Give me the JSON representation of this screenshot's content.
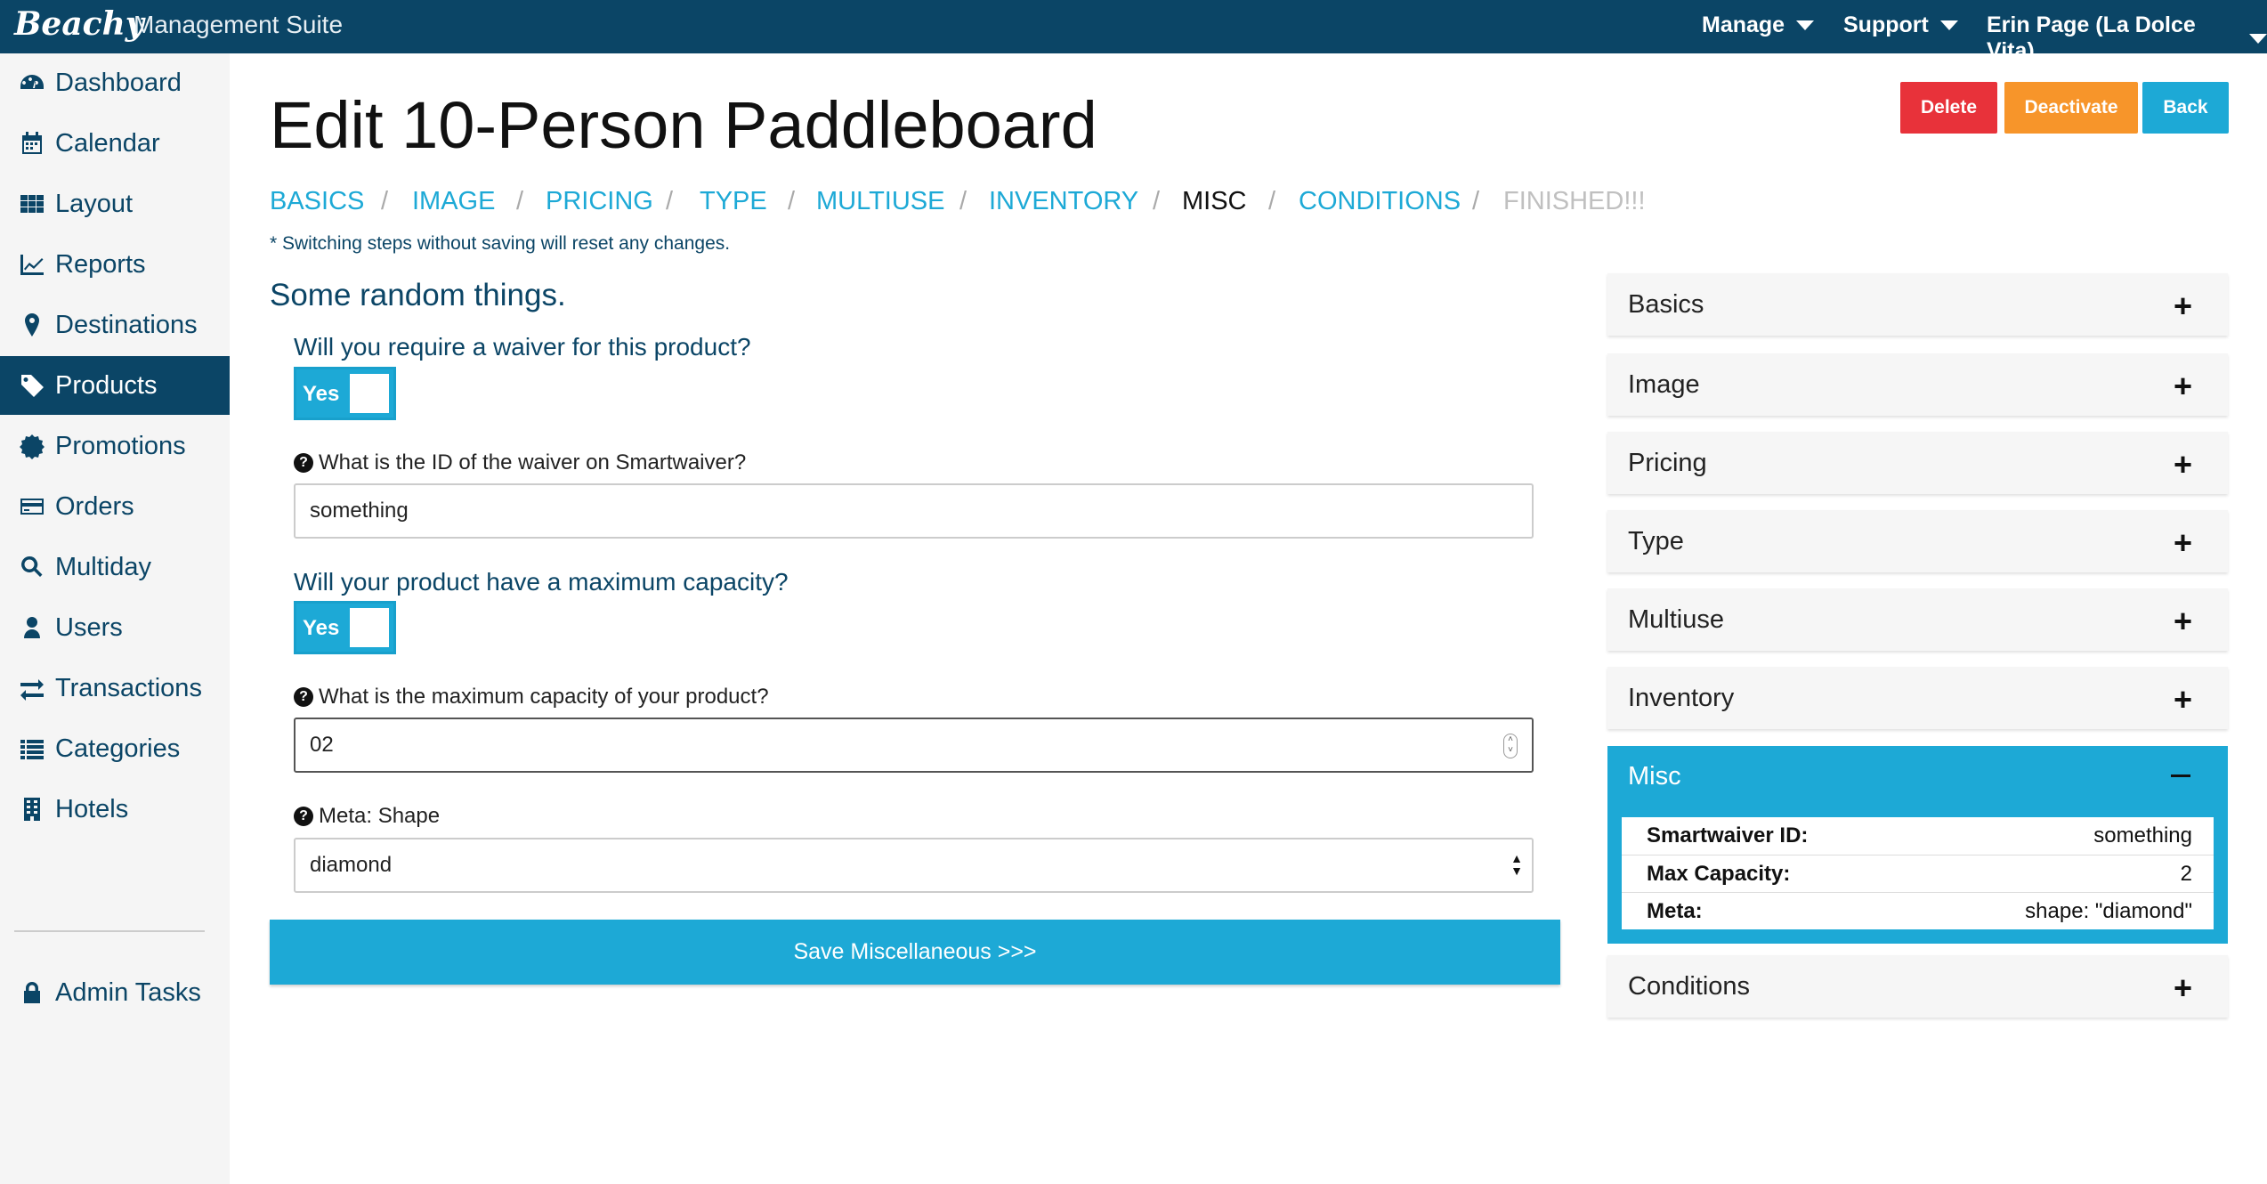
{
  "app": {
    "logo": "Beachy",
    "suite": "Management Suite"
  },
  "topnav": {
    "manage": "Manage",
    "support": "Support",
    "user": "Erin Page (La Dolce Vita)"
  },
  "sidebar": {
    "items": [
      {
        "label": "Dashboard",
        "icon": "dashboard-icon"
      },
      {
        "label": "Calendar",
        "icon": "calendar-icon"
      },
      {
        "label": "Layout",
        "icon": "grid-icon"
      },
      {
        "label": "Reports",
        "icon": "chart-icon"
      },
      {
        "label": "Destinations",
        "icon": "map-marker-icon"
      },
      {
        "label": "Products",
        "icon": "tag-icon",
        "active": true
      },
      {
        "label": "Promotions",
        "icon": "badge-icon"
      },
      {
        "label": "Orders",
        "icon": "credit-card-icon"
      },
      {
        "label": "Multiday",
        "icon": "search-icon"
      },
      {
        "label": "Users",
        "icon": "user-icon"
      },
      {
        "label": "Transactions",
        "icon": "exchange-icon"
      },
      {
        "label": "Categories",
        "icon": "list-icon"
      },
      {
        "label": "Hotels",
        "icon": "building-icon"
      }
    ],
    "admin": {
      "label": "Admin Tasks",
      "icon": "lock-icon"
    }
  },
  "page": {
    "title": "Edit 10-Person Paddleboard"
  },
  "actions": {
    "delete": "Delete",
    "deactivate": "Deactivate",
    "back": "Back"
  },
  "colors": {
    "primary": "#0b4566",
    "accent": "#1da9d6",
    "delete": "#e8323a",
    "deactivate": "#f7952a"
  },
  "steps": {
    "items": [
      "BASICS",
      "IMAGE",
      "PRICING",
      "TYPE",
      "MULTIUSE",
      "INVENTORY",
      "MISC",
      "CONDITIONS",
      "FINISHED!!!"
    ],
    "current": "MISC",
    "separator": "/",
    "note": "* Switching steps without saving will reset any changes."
  },
  "form": {
    "heading": "Some random things.",
    "waiver_question": "Will you require a waiver for this product?",
    "waiver_toggle": "Yes",
    "waiver_id_label": "What is the ID of the waiver on Smartwaiver?",
    "waiver_id_value": "something",
    "capacity_question": "Will your product have a maximum capacity?",
    "capacity_toggle": "Yes",
    "capacity_label": "What is the maximum capacity of your product?",
    "capacity_value": "02",
    "shape_label": "Meta: Shape",
    "shape_value": "diamond",
    "save": "Save Miscellaneous >>>"
  },
  "summary": {
    "panels": [
      "Basics",
      "Image",
      "Pricing",
      "Type",
      "Multiuse",
      "Inventory"
    ],
    "misc": {
      "title": "Misc",
      "rows": [
        {
          "key": "Smartwaiver ID:",
          "value": "something"
        },
        {
          "key": "Max Capacity:",
          "value": "2"
        },
        {
          "key": "Meta:",
          "value": "shape: \"diamond\""
        }
      ]
    },
    "conditions": "Conditions"
  }
}
